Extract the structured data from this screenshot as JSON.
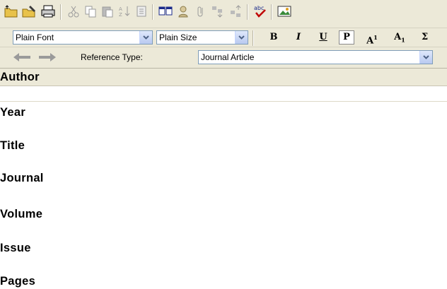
{
  "toolbar": {
    "icons": [
      "open-folder-icon",
      "folder-edit-icon",
      "print-icon",
      "cut-icon",
      "copy-icon",
      "paste-icon",
      "sort-icon",
      "document-icon",
      "window-icon",
      "person-icon",
      "attach-icon",
      "move-down-icon",
      "move-up-icon",
      "spellcheck-icon",
      "insert-picture-icon"
    ],
    "spellcheck_text": "abc"
  },
  "format_bar": {
    "font_value": "Plain Font",
    "size_value": "Plain Size",
    "bold_label": "B",
    "italic_label": "I",
    "underline_label": "U",
    "plain_label": "P",
    "superscript_label": "A",
    "superscript_mark": "1",
    "subscript_label": "A",
    "subscript_mark": "1",
    "symbol_label": "Σ"
  },
  "reference_bar": {
    "label": "Reference Type:",
    "value": "Journal Article"
  },
  "fields": [
    {
      "label": "Author"
    },
    {
      "label": "Year"
    },
    {
      "label": "Title"
    },
    {
      "label": "Journal"
    },
    {
      "label": "Volume"
    },
    {
      "label": "Issue"
    },
    {
      "label": "Pages"
    }
  ],
  "colors": {
    "toolbar_bg": "#ece9d8",
    "combo_border": "#7f9db9",
    "arrow_gray": "#9a9a9a"
  }
}
